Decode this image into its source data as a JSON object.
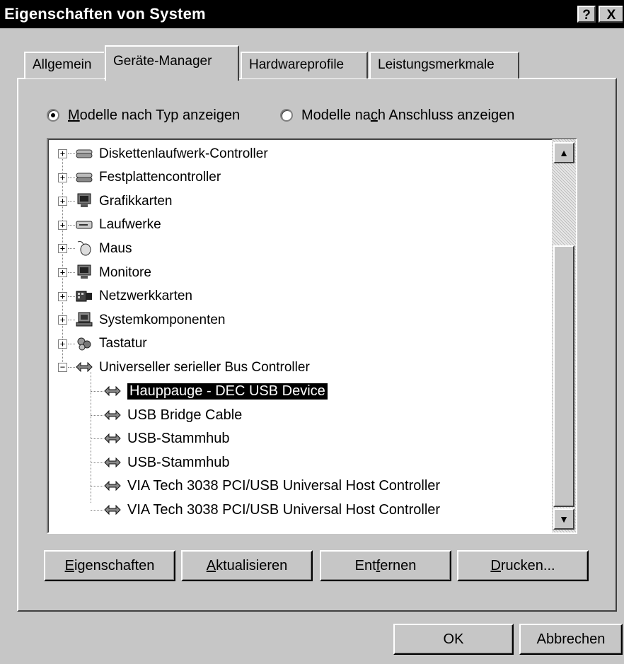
{
  "window": {
    "title": "Eigenschaften von System",
    "help_button": "?",
    "close_button": "X"
  },
  "tabs": [
    {
      "label": "Allgemein",
      "selected": false
    },
    {
      "label": "Geräte-Manager",
      "selected": true
    },
    {
      "label": "Hardwareprofile",
      "selected": false
    },
    {
      "label": "Leistungsmerkmale",
      "selected": false
    }
  ],
  "view_options": {
    "by_type": {
      "prefix": "",
      "accel": "M",
      "rest": "odelle nach Typ anzeigen",
      "checked": true
    },
    "by_connection": {
      "prefix": "Modelle na",
      "accel": "c",
      "rest": "h Anschluss anzeigen",
      "checked": false
    }
  },
  "tree": {
    "categories": [
      {
        "label": "Diskettenlaufwerk-Controller",
        "icon": "floppy-controller-icon",
        "expanded": false
      },
      {
        "label": "Festplattencontroller",
        "icon": "disk-controller-icon",
        "expanded": false
      },
      {
        "label": "Grafikkarten",
        "icon": "display-adapter-icon",
        "expanded": false
      },
      {
        "label": "Laufwerke",
        "icon": "drive-icon",
        "expanded": false
      },
      {
        "label": "Maus",
        "icon": "mouse-icon",
        "expanded": false
      },
      {
        "label": "Monitore",
        "icon": "monitor-icon",
        "expanded": false
      },
      {
        "label": "Netzwerkkarten",
        "icon": "network-card-icon",
        "expanded": false
      },
      {
        "label": "Systemkomponenten",
        "icon": "system-icon",
        "expanded": false
      },
      {
        "label": "Tastatur",
        "icon": "keyboard-icon",
        "expanded": false
      },
      {
        "label": "Universeller serieller Bus Controller",
        "icon": "usb-icon",
        "expanded": true
      }
    ],
    "usb_devices": [
      {
        "label": "Hauppauge - DEC USB Device",
        "selected": true
      },
      {
        "label": "USB Bridge Cable",
        "selected": false
      },
      {
        "label": "USB-Stammhub",
        "selected": false
      },
      {
        "label": "USB-Stammhub",
        "selected": false
      },
      {
        "label": "VIA Tech 3038 PCI/USB Universal Host Controller",
        "selected": false
      },
      {
        "label": "VIA Tech 3038 PCI/USB Universal Host Controller",
        "selected": false
      }
    ],
    "expander_collapsed": "+",
    "expander_expanded": "−"
  },
  "buttons": {
    "properties": {
      "prefix": "",
      "accel": "E",
      "rest": "igenschaften"
    },
    "refresh": {
      "prefix": "",
      "accel": "A",
      "rest": "ktualisieren"
    },
    "remove": {
      "prefix": "Ent",
      "accel": "f",
      "rest": "ernen"
    },
    "print": {
      "prefix": "",
      "accel": "D",
      "rest": "rucken..."
    },
    "ok": "OK",
    "cancel": "Abbrechen"
  }
}
